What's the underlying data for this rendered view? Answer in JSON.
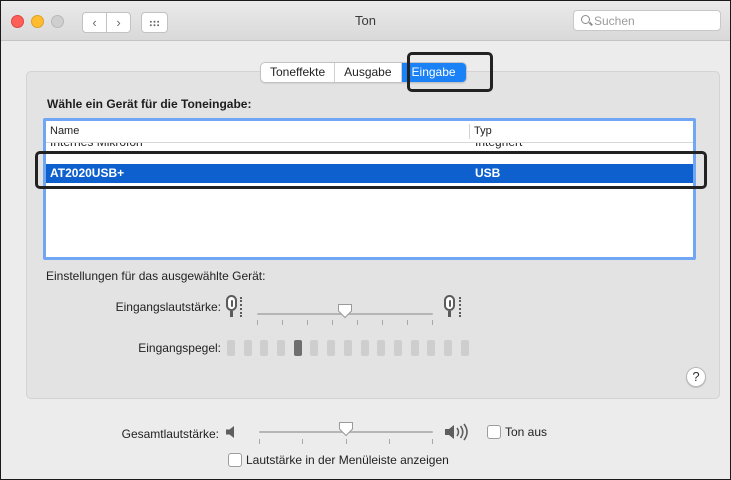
{
  "window": {
    "title": "Ton"
  },
  "toolbar": {
    "back_icon": "chevron-left",
    "forward_icon": "chevron-right",
    "grid_icon": "grid-dots",
    "back_label": "‹",
    "forward_label": "›",
    "search_placeholder": "Suchen"
  },
  "tabs": [
    {
      "label": "Toneffekte",
      "selected": false
    },
    {
      "label": "Ausgabe",
      "selected": false
    },
    {
      "label": "Eingabe",
      "selected": true
    }
  ],
  "input": {
    "heading": "Wähle ein Gerät für die Toneingabe:",
    "table": {
      "columns": [
        "Name",
        "Typ"
      ],
      "rows": [
        {
          "name": "Internes Mikrofon",
          "type": "Integriert",
          "selected": false
        },
        {
          "name": "AT2020USB+",
          "type": "USB",
          "selected": true
        }
      ]
    },
    "settings_heading": "Einstellungen für das ausgewählte Gerät:",
    "input_volume_label": "Eingangslautstärke:",
    "input_volume": 0.5,
    "input_level_label": "Eingangspegel:",
    "input_level_segments": 15,
    "input_level_active": 5,
    "help_label": "?"
  },
  "output": {
    "total_volume_label": "Gesamtlautstärke:",
    "total_volume": 0.5,
    "mute_label": "Ton aus",
    "mute_checked": false,
    "menubar_label": "Lautstärke in der Menüleiste anzeigen",
    "menubar_checked": false
  },
  "colors": {
    "accent": "#1a81f7",
    "selection": "#0f60cf",
    "focus_ring": "#70a6f3",
    "highlight_frame": "#222222"
  }
}
